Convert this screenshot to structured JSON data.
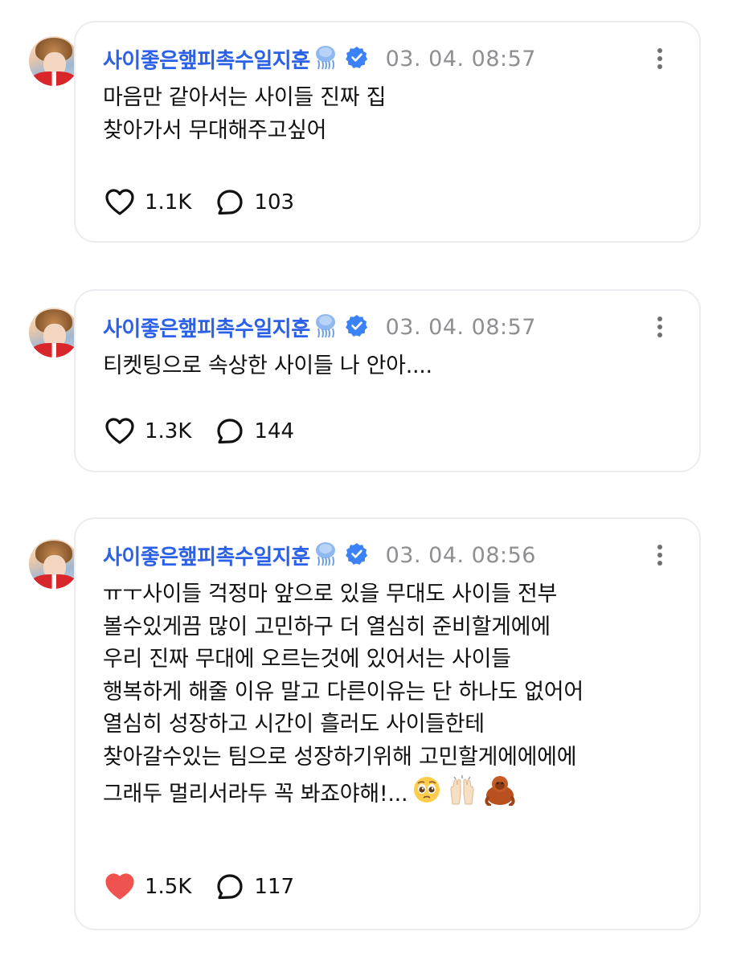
{
  "posts": [
    {
      "author": "사이좋은햎피촉수일지훈",
      "timestamp": "03. 04. 08:57",
      "lines": [
        "마음만 같아서는 사이들 진짜 집",
        "찾아가서 무대해주고싶어"
      ],
      "likes": "1.1K",
      "comments": "103",
      "liked": false
    },
    {
      "author": "사이좋은햎피촉수일지훈",
      "timestamp": "03. 04. 08:57",
      "lines": [
        "티켓팅으로 속상한 사이들 나 안아...."
      ],
      "likes": "1.3K",
      "comments": "144",
      "liked": false
    },
    {
      "author": "사이좋은햎피촉수일지훈",
      "timestamp": "03. 04. 08:56",
      "lines": [
        "ㅠㅜ사이들 걱정마 앞으로 있을 무대도 사이들 전부",
        "볼수있게끔 많이 고민하구 더 열심히 준비할게에에",
        "우리 진짜 무대에 오르는것에 있어서는 사이들",
        "행복하게 해줄 이유 말고 다른이유는 단 하나도 없어어",
        "열심히 성장하고 시간이 흘러도 사이들한테",
        "찾아갈수있는 팀으로 성장하기위해 고민할게에에에에",
        "그래두 멀리서라두 꼭 봐죠야해!..."
      ],
      "trailing_emojis": [
        "pleading-face-emoji",
        "raising-hands-emoji",
        "orangutan-emoji"
      ],
      "likes": "1.5K",
      "comments": "117",
      "liked": true
    }
  ],
  "icons": {
    "author_emoji": "jellyfish-emoji",
    "verified": "verified-badge-icon",
    "more": "more-options-icon",
    "like": "heart-icon",
    "comment": "comment-bubble-icon"
  },
  "colors": {
    "author": "#2b60e8",
    "verified_badge": "#3b82f6",
    "timestamp": "#8e8e93",
    "liked_heart": "#f0524f",
    "card_border": "#ececf1"
  }
}
